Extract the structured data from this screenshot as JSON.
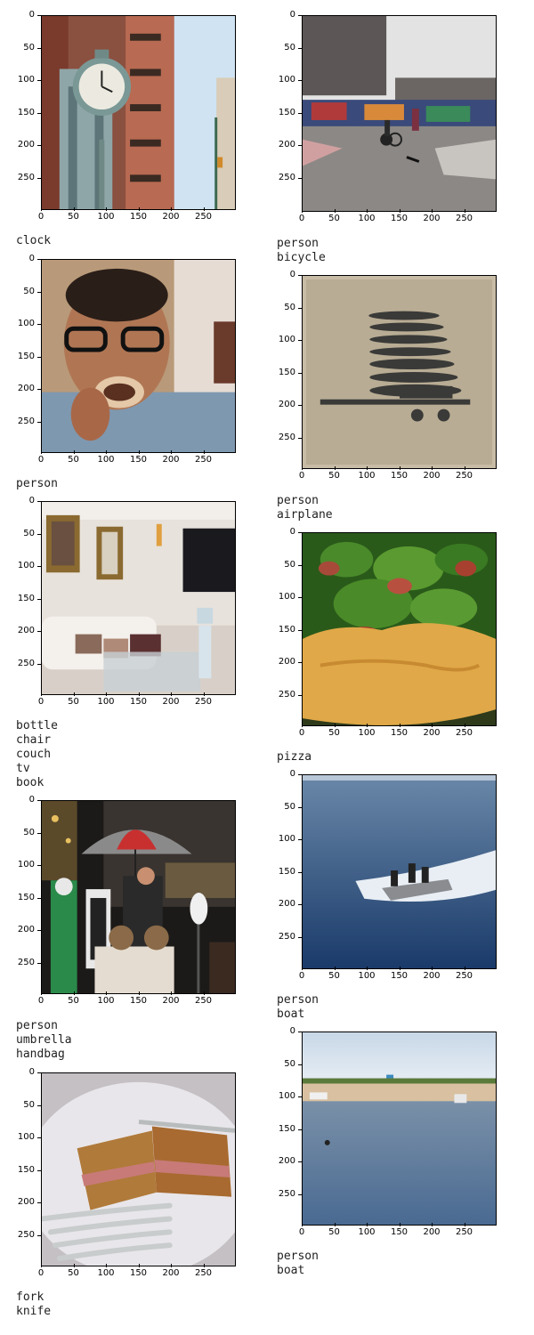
{
  "axis": {
    "yticks": [
      "0",
      "50",
      "100",
      "150",
      "200",
      "250"
    ],
    "xticks": [
      "0",
      "50",
      "100",
      "150",
      "200",
      "250"
    ]
  },
  "panels": [
    {
      "id": "p1",
      "labels": [
        "clock"
      ],
      "scene": "clock-street"
    },
    {
      "id": "p2",
      "labels": [
        "person",
        "bicycle"
      ],
      "scene": "skatepark"
    },
    {
      "id": "p3",
      "labels": [
        "person"
      ],
      "scene": "man-eating"
    },
    {
      "id": "p4",
      "labels": [
        "person",
        "airplane"
      ],
      "scene": "biplanes"
    },
    {
      "id": "p5",
      "labels": [
        "bottle",
        "chair",
        "couch",
        "tv",
        "book"
      ],
      "scene": "living-room"
    },
    {
      "id": "p6",
      "labels": [
        "pizza"
      ],
      "scene": "pizza"
    },
    {
      "id": "p7",
      "labels": [
        "person",
        "umbrella",
        "handbag"
      ],
      "scene": "umbrella-crowd"
    },
    {
      "id": "p8",
      "labels": [
        "person",
        "boat"
      ],
      "scene": "speedboat"
    },
    {
      "id": "p9",
      "labels": [
        "fork",
        "knife"
      ],
      "scene": "sandwich"
    },
    {
      "id": "p10",
      "labels": [
        "person",
        "boat"
      ],
      "scene": "beach-water"
    }
  ]
}
